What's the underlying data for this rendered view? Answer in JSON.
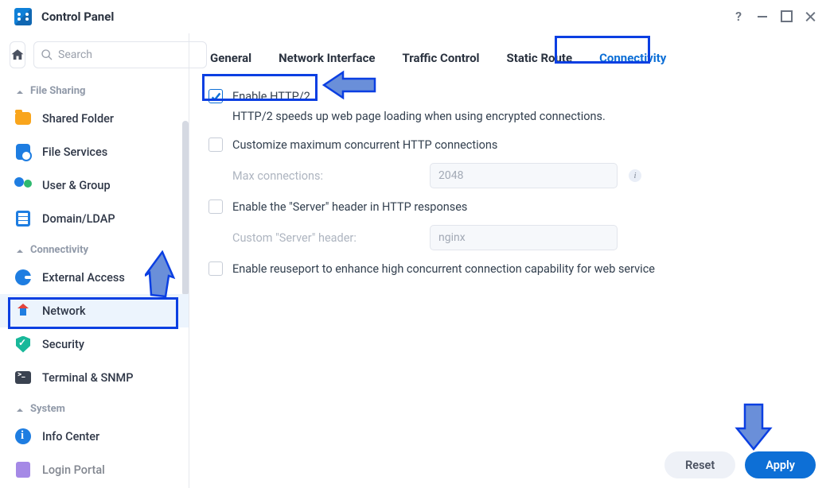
{
  "window": {
    "title": "Control Panel"
  },
  "search": {
    "placeholder": "Search"
  },
  "sidebar": {
    "sections": {
      "file_sharing": {
        "label": "File Sharing"
      },
      "connectivity": {
        "label": "Connectivity"
      },
      "system": {
        "label": "System"
      }
    },
    "items": {
      "shared_folder": {
        "label": "Shared Folder"
      },
      "file_services": {
        "label": "File Services"
      },
      "user_group": {
        "label": "User & Group"
      },
      "domain_ldap": {
        "label": "Domain/LDAP"
      },
      "external_access": {
        "label": "External Access"
      },
      "network": {
        "label": "Network"
      },
      "security": {
        "label": "Security"
      },
      "terminal_snmp": {
        "label": "Terminal & SNMP"
      },
      "info_center": {
        "label": "Info Center"
      },
      "login_portal": {
        "label": "Login Portal"
      }
    }
  },
  "tabs": {
    "general": "General",
    "network_interface": "Network Interface",
    "traffic_control": "Traffic Control",
    "static_route": "Static Route",
    "connectivity": "Connectivity"
  },
  "content": {
    "enable_http2": {
      "label": "Enable HTTP/2",
      "checked": true
    },
    "http2_help": "HTTP/2 speeds up web page loading when using encrypted connections.",
    "customize_max": {
      "label": "Customize maximum concurrent HTTP connections",
      "checked": false
    },
    "max_conn_label": "Max connections:",
    "max_conn_value": "2048",
    "server_header": {
      "label": "Enable the \"Server\" header in HTTP responses",
      "checked": false
    },
    "custom_server_label": "Custom \"Server\" header:",
    "custom_server_value": "nginx",
    "reuseport": {
      "label": "Enable reuseport to enhance high concurrent connection capability for web service",
      "checked": false
    }
  },
  "footer": {
    "reset": "Reset",
    "apply": "Apply"
  }
}
